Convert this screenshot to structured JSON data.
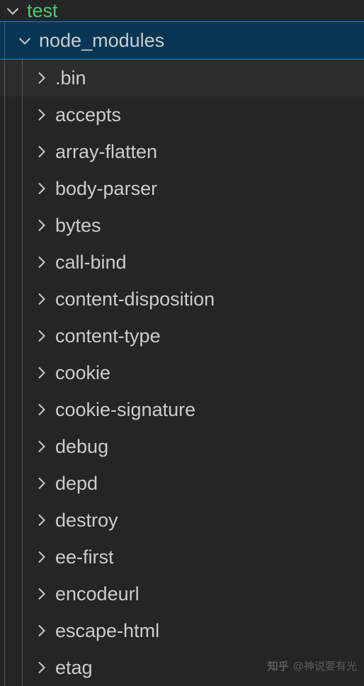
{
  "root": {
    "label": "test",
    "expanded": true
  },
  "selected": {
    "label": "node_modules",
    "expanded": true
  },
  "folders": [
    {
      "label": ".bin",
      "hover": true
    },
    {
      "label": "accepts",
      "hover": false
    },
    {
      "label": "array-flatten",
      "hover": false
    },
    {
      "label": "body-parser",
      "hover": false
    },
    {
      "label": "bytes",
      "hover": false
    },
    {
      "label": "call-bind",
      "hover": false
    },
    {
      "label": "content-disposition",
      "hover": false
    },
    {
      "label": "content-type",
      "hover": false
    },
    {
      "label": "cookie",
      "hover": false
    },
    {
      "label": "cookie-signature",
      "hover": false
    },
    {
      "label": "debug",
      "hover": false
    },
    {
      "label": "depd",
      "hover": false
    },
    {
      "label": "destroy",
      "hover": false
    },
    {
      "label": "ee-first",
      "hover": false
    },
    {
      "label": "encodeurl",
      "hover": false
    },
    {
      "label": "escape-html",
      "hover": false
    },
    {
      "label": "etag",
      "hover": false
    }
  ],
  "watermark": {
    "brand": "知乎",
    "author": "@神说要有光"
  },
  "colors": {
    "bg": "#252526",
    "text": "#cccccc",
    "rootText": "#4ec96f",
    "selectedBg": "#073655",
    "selectedBorder": "#0a7fd4",
    "hoverBg": "#2a2d2e",
    "indentGuide": "#585858",
    "chevron": "#c5c5c5"
  }
}
